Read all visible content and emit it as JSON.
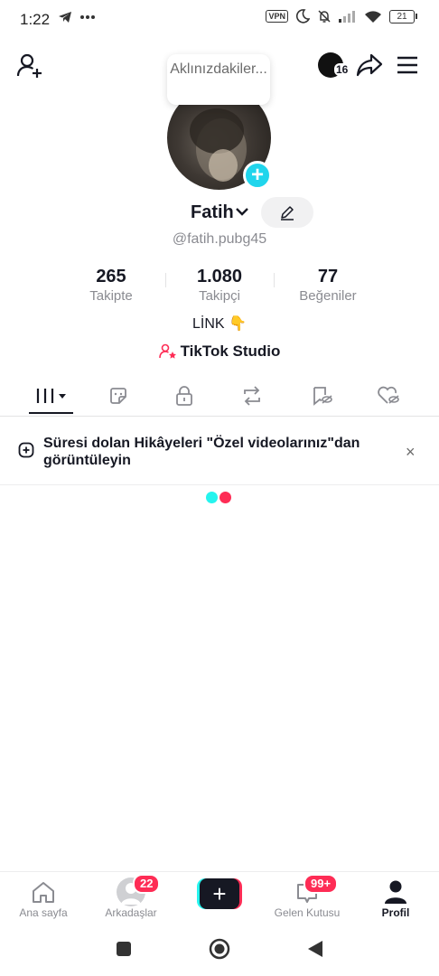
{
  "status_bar": {
    "time": "1:22",
    "vpn": "VPN",
    "battery": "21"
  },
  "header": {
    "bubble_text": "Aklınızdakiler...",
    "avatar_count": "16"
  },
  "profile": {
    "name": "Fatih",
    "handle": "@fatih.pubg45",
    "stats": [
      {
        "value": "265",
        "label": "Takipte"
      },
      {
        "value": "1.080",
        "label": "Takipçi"
      },
      {
        "value": "77",
        "label": "Beğeniler"
      }
    ],
    "bio": "LİNK 👇",
    "studio_label": "TikTok Studio"
  },
  "tabs": [
    {
      "icon": "grid-icon",
      "active": true
    },
    {
      "icon": "sticker-icon"
    },
    {
      "icon": "lock-icon"
    },
    {
      "icon": "repost-icon"
    },
    {
      "icon": "bookmark-hidden-icon"
    },
    {
      "icon": "heart-hidden-icon"
    }
  ],
  "banner": {
    "text": "Süresi dolan Hikâyeleri \"Özel videolarınız\"dan görüntüleyin",
    "close": "×"
  },
  "bottom_nav": {
    "home": "Ana sayfa",
    "friends": "Arkadaşlar",
    "friends_badge": "22",
    "create": "+",
    "inbox": "Gelen Kutusu",
    "inbox_badge": "99+",
    "profile": "Profil"
  },
  "colors": {
    "accent_cyan": "#20d5ec",
    "accent_red": "#fe2c55",
    "text": "#161823",
    "muted": "#8a8b91"
  }
}
